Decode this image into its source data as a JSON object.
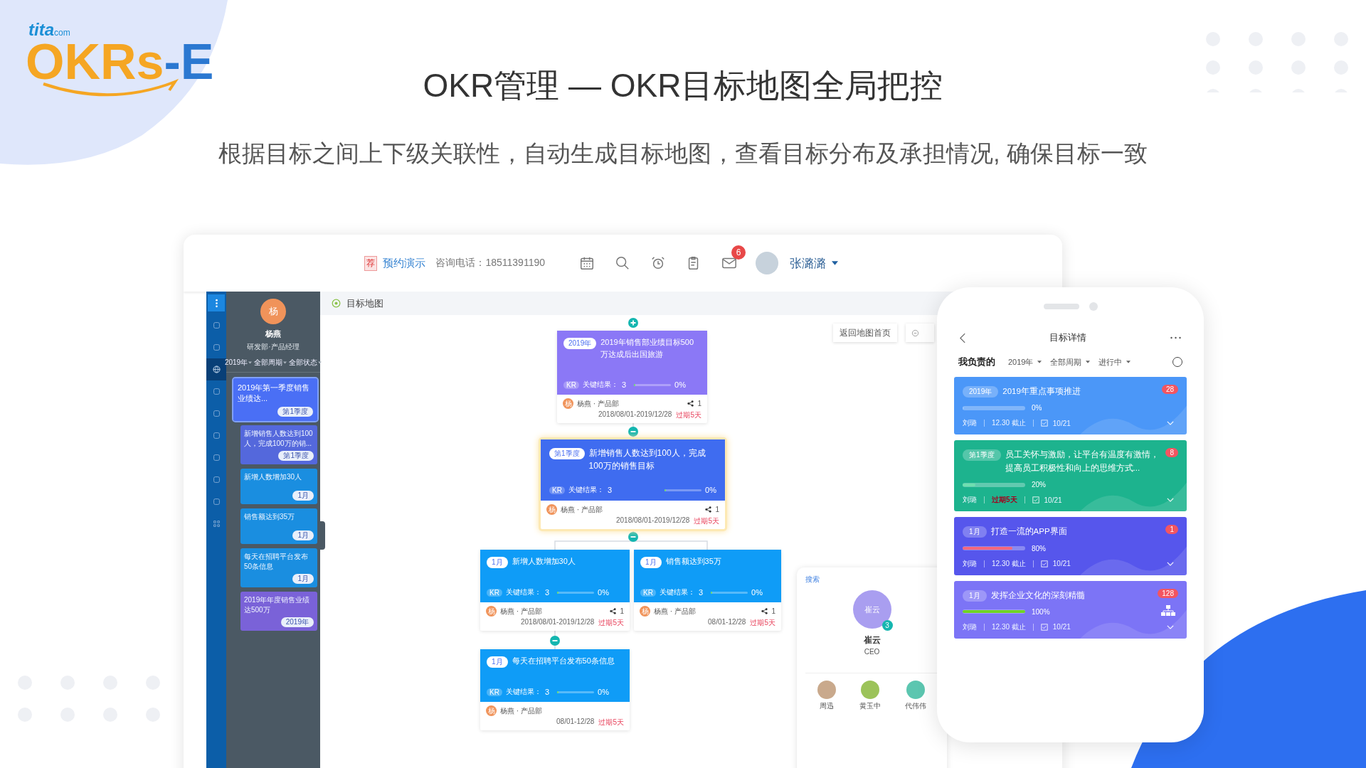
{
  "logo": {
    "brand_small": "tita",
    "brand_small_suffix": "com",
    "brand_main": "OKRs",
    "brand_suffix": "-E"
  },
  "headline": "OKR管理 — OKR目标地图全局把控",
  "subtitle": "根据目标之间上下级关联性，自动生成目标地图，查看目标分布及承担情况, 确保目标一致",
  "window": {
    "topbar": {
      "promo_badge": "荐",
      "demo_link": "预约演示",
      "hotline": "咨询电话：18511391190",
      "mail_badge": "6",
      "user_name": "张潞潞"
    },
    "rail_items": [
      {
        "selected": false
      },
      {
        "selected": false
      },
      {
        "selected": false
      },
      {
        "selected": true
      },
      {
        "selected": false
      },
      {
        "selected": false
      },
      {
        "selected": false
      },
      {
        "selected": false
      },
      {
        "selected": false
      },
      {
        "selected": false
      },
      {
        "selected": false
      }
    ],
    "profile": {
      "avatar": "杨",
      "name": "杨燕",
      "dept": "研发部·产品经理"
    },
    "filters": [
      "2019年",
      "全部周期",
      "全部状态"
    ],
    "goal_list": [
      {
        "title": "2019年第一季度销售业绩达...",
        "tag": "第1季度",
        "color": "#4a6ff5",
        "selected": true,
        "children": [
          {
            "title": "新增销售人数达到100人，完成100万的销...",
            "tag": "第1季度",
            "color": "#5468dc",
            "selected": false
          },
          {
            "title": "新增人数增加30人",
            "tag": "1月",
            "color": "#1a8ee0",
            "selected": false
          },
          {
            "title": "销售额达到35万",
            "tag": "1月",
            "color": "#1a8ee0",
            "selected": false
          },
          {
            "title": "每天在招聘平台发布50条信息",
            "tag": "1月",
            "color": "#1a8ee0",
            "selected": false
          },
          {
            "title": "2019年年度销售业绩达500万",
            "tag": "2019年",
            "color": "#7a62d8",
            "selected": false
          }
        ]
      }
    ],
    "page_title": "目标地图",
    "map": {
      "back_button": "返回地图首页",
      "nodes": [
        {
          "tag": "2019年",
          "title": "2019年销售部业绩目标500万达成后出国旅游",
          "kr_badge": "KR",
          "kr_label": "关键结果：",
          "kr_count": "3",
          "level": 0.04,
          "percent": "0%",
          "owner_avatar": "杨",
          "owner": "杨燕 · 产品部",
          "dates": "2018/08/01-2019/12/28",
          "overdue": "过期5天",
          "links": "1",
          "color": "#8b78f6",
          "selected": false
        },
        {
          "tag": "第1季度",
          "title": "新增销售人数达到100人，完成100万的销售目标",
          "kr_badge": "KR",
          "kr_label": "关键结果：",
          "kr_count": "3",
          "level": 0.04,
          "percent": "0%",
          "owner_avatar": "杨",
          "owner": "杨燕 · 产品部",
          "dates": "2018/08/01-2019/12/28",
          "overdue": "过期5天",
          "links": "1",
          "color": "#3f6cf0",
          "selected": true
        },
        {
          "tag": "1月",
          "title": "新增人数增加30人",
          "kr_badge": "KR",
          "kr_label": "关键结果：",
          "kr_count": "3",
          "level": 0.04,
          "percent": "0%",
          "owner_avatar": "杨",
          "owner": "杨燕 · 产品部",
          "dates": "2018/08/01-2019/12/28",
          "overdue": "过期5天",
          "links": "1",
          "color": "#0f9cf7",
          "selected": false
        },
        {
          "tag": "1月",
          "title": "销售额达到35万",
          "kr_badge": "KR",
          "kr_label": "关键结果：",
          "kr_count": "3",
          "level": 0.04,
          "percent": "0%",
          "owner_avatar": "杨",
          "owner": "杨燕 · 产品部",
          "dates": "08/01-12/28",
          "overdue": "过期5天",
          "links": "1",
          "color": "#0f9cf7",
          "selected": false
        },
        {
          "tag": "1月",
          "title": "每天在招聘平台发布50条信息",
          "kr_badge": "KR",
          "kr_label": "关键结果：",
          "kr_count": "3",
          "level": 0.04,
          "percent": "0%",
          "owner_avatar": "杨",
          "owner": "杨燕 · 产品部",
          "dates": "08/01-12/28",
          "overdue": "过期5天",
          "color": "#0f9cf7",
          "selected": false
        }
      ]
    },
    "org_panel": {
      "search": "搜索",
      "avatar": "崔云",
      "count": "3",
      "name": "崔云",
      "role": "CEO",
      "members": [
        {
          "name": "周迅",
          "color": "#c9a98c"
        },
        {
          "name": "黄玉中",
          "color": "#9cc35a"
        },
        {
          "name": "代伟伟",
          "color": "#5cc6b0"
        }
      ]
    }
  },
  "phone": {
    "title": "目标详情",
    "scope": "我负责的",
    "filters": [
      "2019年",
      "全部周期",
      "进行中"
    ],
    "cards": [
      {
        "tag": "2019年",
        "title": "2019年重点事项推进",
        "badge": "28",
        "progress": {
          "level": 0,
          "color": "#8fc0ff"
        },
        "percent": "0%",
        "owner": "刘璐",
        "deadline": "12.30 截止",
        "overdue": false,
        "checks": "10/21",
        "color": "#4b97f8"
      },
      {
        "tag": "第1季度",
        "title": "员工关怀与激励，让平台有温度有激情，提高员工积极性和向上的思维方式...",
        "badge": "8",
        "progress": {
          "level": 0.2,
          "color": "#6fe0b0"
        },
        "percent": "20%",
        "owner": "刘璐",
        "deadline": "过期5天",
        "overdue": true,
        "checks": "10/21",
        "color": "#1db38e"
      },
      {
        "tag": "1月",
        "title": "打造一流的APP界面",
        "badge": "1",
        "progress": {
          "level": 0.8,
          "color": "#f4677e"
        },
        "percent": "80%",
        "owner": "刘璐",
        "deadline": "12.30 截止",
        "overdue": false,
        "checks": "10/21",
        "color": "#5656ec"
      },
      {
        "tag": "1月",
        "title": "发挥企业文化的深刻精髓",
        "badge": "128",
        "progress": {
          "level": 1,
          "color": "#6fd424"
        },
        "percent": "100%",
        "owner": "刘璐",
        "deadline": "12.30 截止",
        "overdue": false,
        "checks": "10/21",
        "color": "#7c74f6",
        "org_icon": true
      }
    ]
  }
}
